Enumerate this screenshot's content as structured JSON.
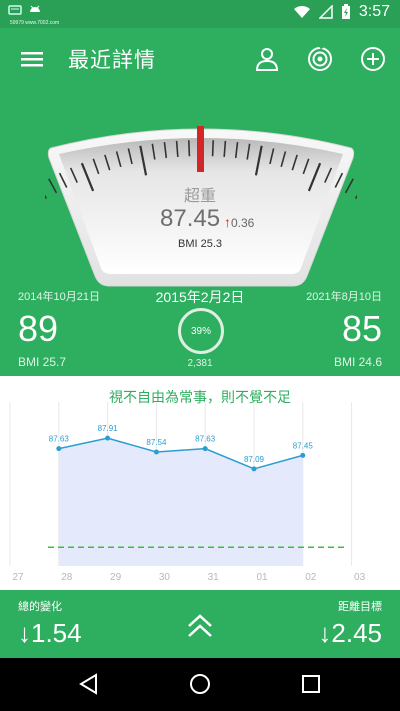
{
  "status_bar": {
    "time": "3:57",
    "tiny_text": "59979 www.7002.com",
    "icons": [
      "message-icon",
      "android-icon",
      "wifi-icon",
      "signal-icon",
      "battery-charging-icon"
    ]
  },
  "app_bar": {
    "title": "最近詳情",
    "icons": [
      "menu-icon",
      "profile-icon",
      "sync-icon",
      "add-icon"
    ]
  },
  "scale": {
    "status": "超重",
    "weight": "87.45",
    "delta": "0.36",
    "bmi": "BMI 25.3"
  },
  "summary": {
    "start_date": "2014年10月21日",
    "current_date": "2015年2月2日",
    "end_date": "2021年8月10日",
    "start_value": "89",
    "end_value": "85",
    "start_bmi": "BMI 25.7",
    "end_bmi": "BMI 24.6",
    "progress": "39%",
    "progress_count": "2,381"
  },
  "quote": "視不自由為常事，則不覺不足",
  "chart_data": {
    "type": "area",
    "categories": [
      "27",
      "28",
      "29",
      "30",
      "31",
      "01",
      "02",
      "03"
    ],
    "points": [
      {
        "x": "28",
        "y": 87.63,
        "label": "87.63"
      },
      {
        "x": "29",
        "y": 87.91,
        "label": "87.91"
      },
      {
        "x": "30",
        "y": 87.54,
        "label": "87.54"
      },
      {
        "x": "31",
        "y": 87.63,
        "label": "87.63"
      },
      {
        "x": "01",
        "y": 87.09,
        "label": "87.09"
      },
      {
        "x": "02",
        "y": 87.45,
        "label": "87.45"
      }
    ],
    "goal_line": 85,
    "colors": {
      "line": "#2a9ed0",
      "fill": "#e4e9fb",
      "goal": "#3bbf3b"
    }
  },
  "bottom": {
    "total_label": "總的變化",
    "goal_label": "距離目標",
    "total_value": "1.54",
    "goal_value": "2.45"
  },
  "nav": [
    "back-icon",
    "home-icon",
    "recents-icon"
  ]
}
